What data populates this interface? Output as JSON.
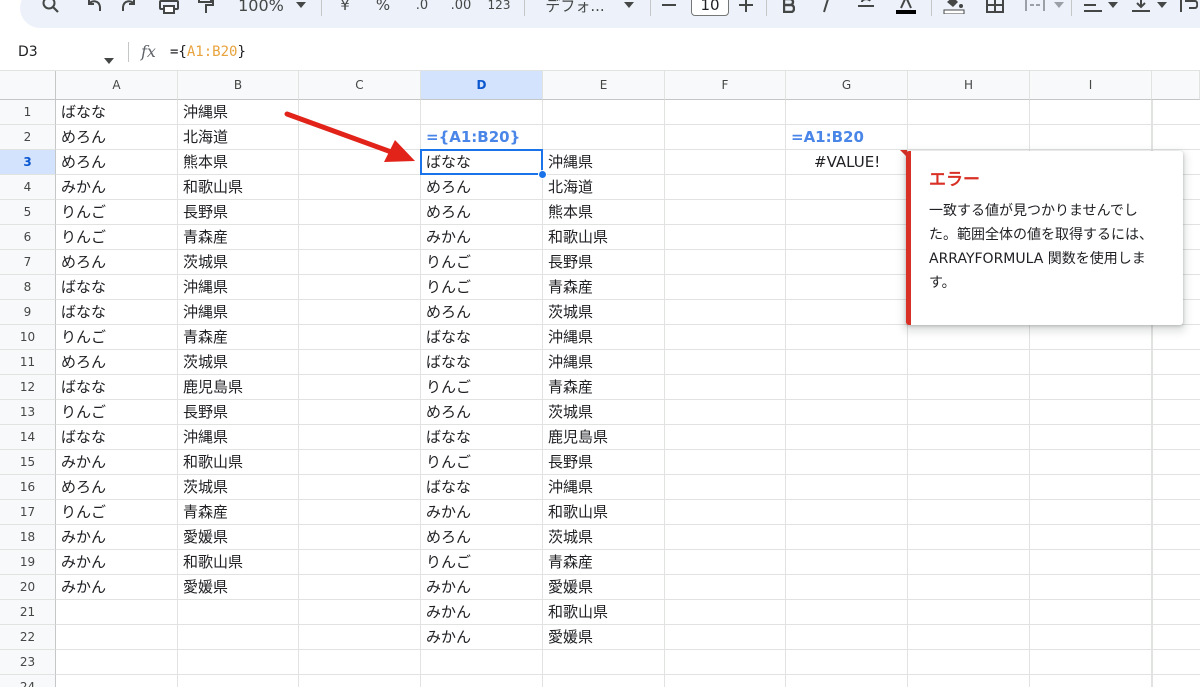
{
  "toolbar": {
    "zoom": "100%",
    "currency": "¥",
    "percent": "%",
    "decimal_less": ".0",
    "decimal_more": ".00",
    "number_format": "123",
    "font": "デフォ...",
    "font_size": "10",
    "icons": [
      "search-icon",
      "undo-icon",
      "redo-icon",
      "print-icon",
      "paint-format-icon",
      "chevron-down-icon",
      "minus-icon",
      "plus-icon",
      "bold-icon",
      "italic-icon",
      "strikethrough-icon",
      "text-color-icon",
      "fill-color-icon",
      "borders-icon",
      "merge-icon",
      "align-icon",
      "valign-icon",
      "wrap-icon"
    ]
  },
  "formula_bar": {
    "cell_ref": "D3",
    "fx": "fx",
    "formula_prefix": "={",
    "formula_ref": "A1:B20",
    "formula_suffix": "}"
  },
  "grid": {
    "columns": [
      "A",
      "B",
      "C",
      "D",
      "E",
      "F",
      "G",
      "H",
      "I"
    ],
    "selected_column": "D",
    "selected_row": 3,
    "rows": [
      "1",
      "2",
      "3",
      "4",
      "5",
      "6",
      "7",
      "8",
      "9",
      "10",
      "11",
      "12",
      "13",
      "14",
      "15",
      "16",
      "17",
      "18",
      "19",
      "20",
      "21",
      "22",
      "23",
      "24"
    ],
    "col_a": [
      "ばなな",
      "めろん",
      "めろん",
      "みかん",
      "りんご",
      "りんご",
      "めろん",
      "ばなな",
      "ばなな",
      "りんご",
      "めろん",
      "ばなな",
      "りんご",
      "ばなな",
      "みかん",
      "めろん",
      "りんご",
      "みかん",
      "みかん",
      "みかん"
    ],
    "col_b": [
      "沖縄県",
      "北海道",
      "熊本県",
      "和歌山県",
      "長野県",
      "青森産",
      "茨城県",
      "沖縄県",
      "沖縄県",
      "青森産",
      "茨城県",
      "鹿児島県",
      "長野県",
      "沖縄県",
      "和歌山県",
      "茨城県",
      "青森産",
      "愛媛県",
      "和歌山県",
      "愛媛県"
    ],
    "d2_formula": "={A1:B20}",
    "col_d": [
      "ばなな",
      "めろん",
      "めろん",
      "みかん",
      "りんご",
      "りんご",
      "めろん",
      "ばなな",
      "ばなな",
      "りんご",
      "めろん",
      "ばなな",
      "りんご",
      "ばなな",
      "みかん",
      "めろん",
      "りんご",
      "みかん",
      "みかん",
      "みかん"
    ],
    "col_e": [
      "沖縄県",
      "北海道",
      "熊本県",
      "和歌山県",
      "長野県",
      "青森産",
      "茨城県",
      "沖縄県",
      "沖縄県",
      "青森産",
      "茨城県",
      "鹿児島県",
      "長野県",
      "沖縄県",
      "和歌山県",
      "茨城県",
      "青森産",
      "愛媛県",
      "和歌山県",
      "愛媛県"
    ],
    "g2_formula": "=A1:B20",
    "g3_value": "#VALUE!"
  },
  "error_popup": {
    "title": "エラー",
    "message": "一致する値が見つかりませんでした。範囲全体の値を取得するには、ARRAYFORMULA 関数を使用します。"
  },
  "colors": {
    "selection": "#1a73e8",
    "header_selected": "#d3e3fd",
    "formula_label": "#4a86e8",
    "error": "#d93025",
    "arrow": "#e2231a"
  }
}
